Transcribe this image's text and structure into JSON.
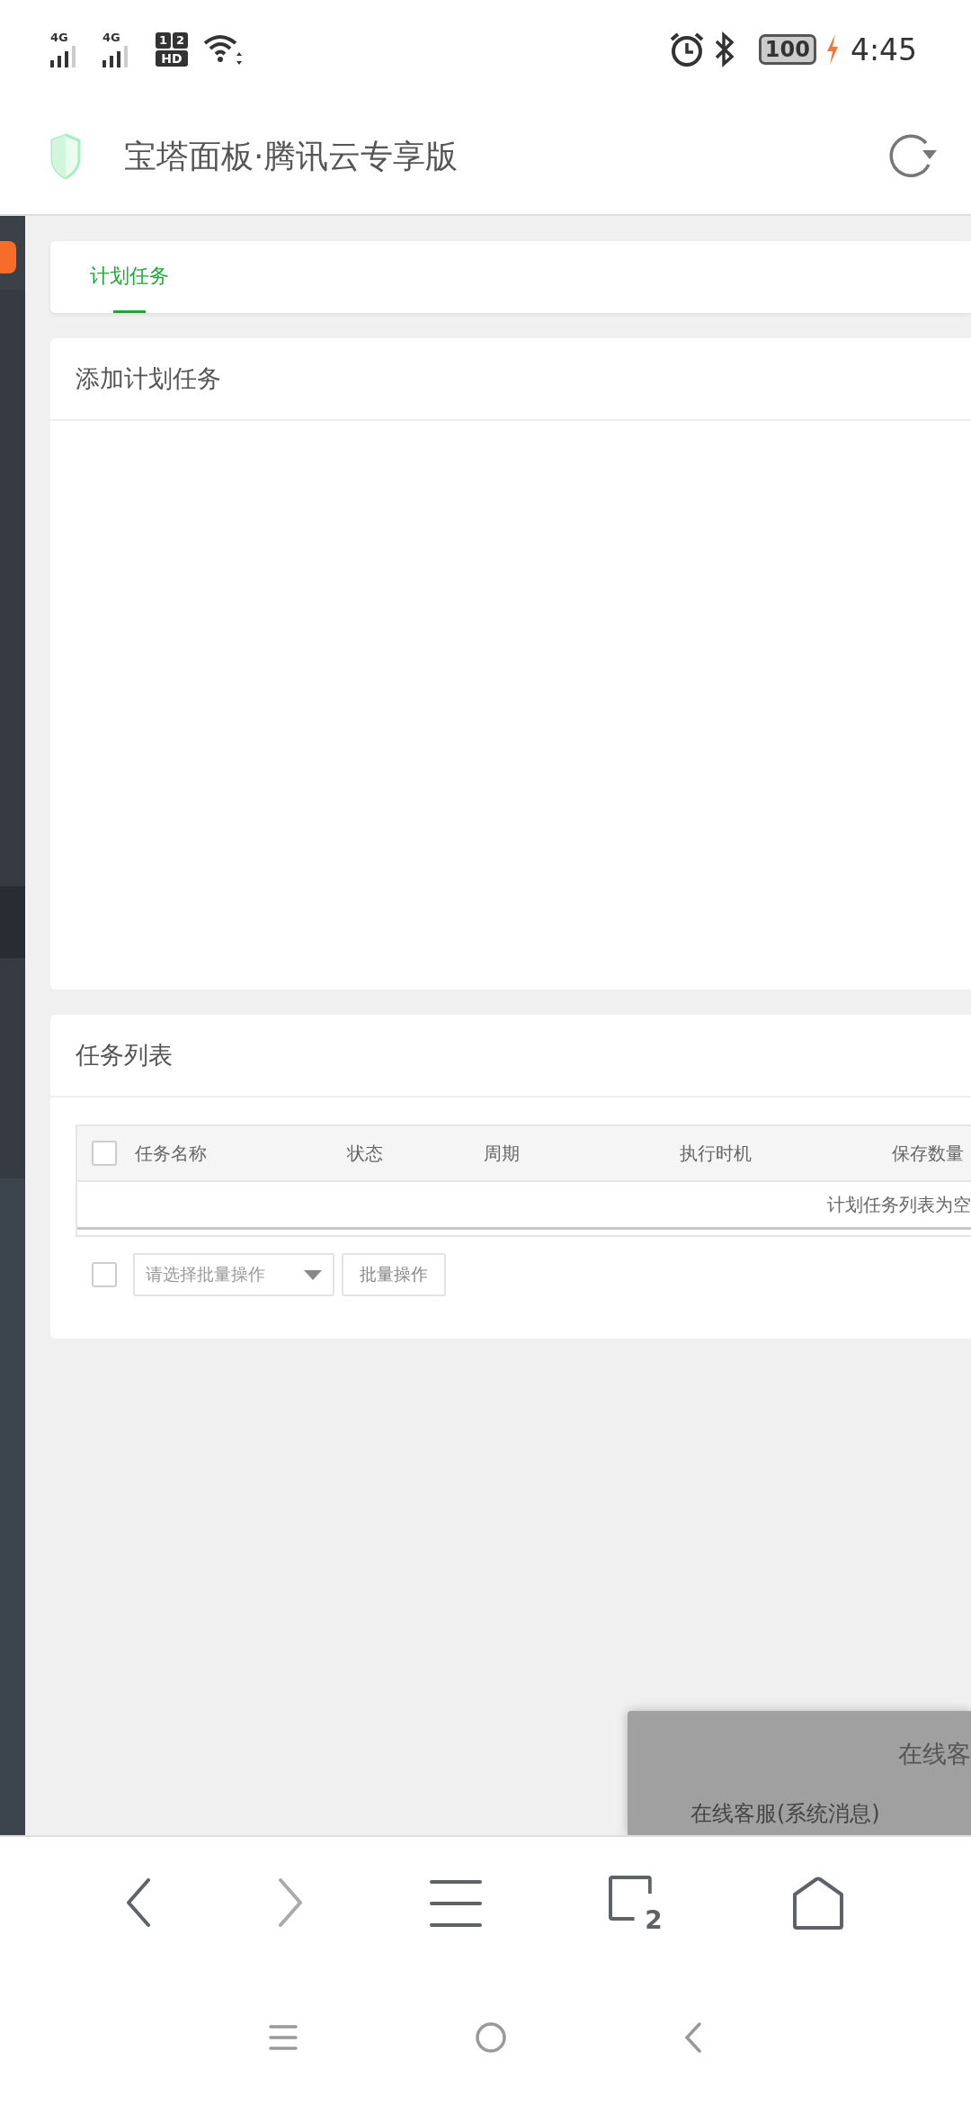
{
  "status_bar": {
    "signals": [
      {
        "label": "4G"
      },
      {
        "label": "4G"
      }
    ],
    "hd_badge": [
      "1",
      "2",
      "HD"
    ],
    "battery": "100",
    "charging": true,
    "time": "4:45"
  },
  "header": {
    "title": "宝塔面板·腾讯云专享版"
  },
  "tabs": [
    {
      "label": "计划任务",
      "selected": true
    }
  ],
  "add_panel": {
    "title": "添加计划任务"
  },
  "task_list": {
    "title": "任务列表",
    "select_all": {
      "checked": false
    },
    "columns": [
      "任务名称",
      "状态",
      "周期",
      "执行时机",
      "保存数量"
    ],
    "empty_text": "计划任务列表为空",
    "batch": {
      "checked": false,
      "placeholder": "请选择批量操作",
      "button": "批量操作"
    }
  },
  "chat_popup": {
    "title": "在线客",
    "item": "在线客服(系统消息)"
  },
  "browser_toolbar": [
    {
      "kind": "back",
      "disabled": false
    },
    {
      "kind": "forward",
      "disabled": true
    },
    {
      "kind": "menu",
      "disabled": false
    },
    {
      "kind": "tabs",
      "disabled": false,
      "count": "2"
    },
    {
      "kind": "home",
      "disabled": false
    }
  ]
}
